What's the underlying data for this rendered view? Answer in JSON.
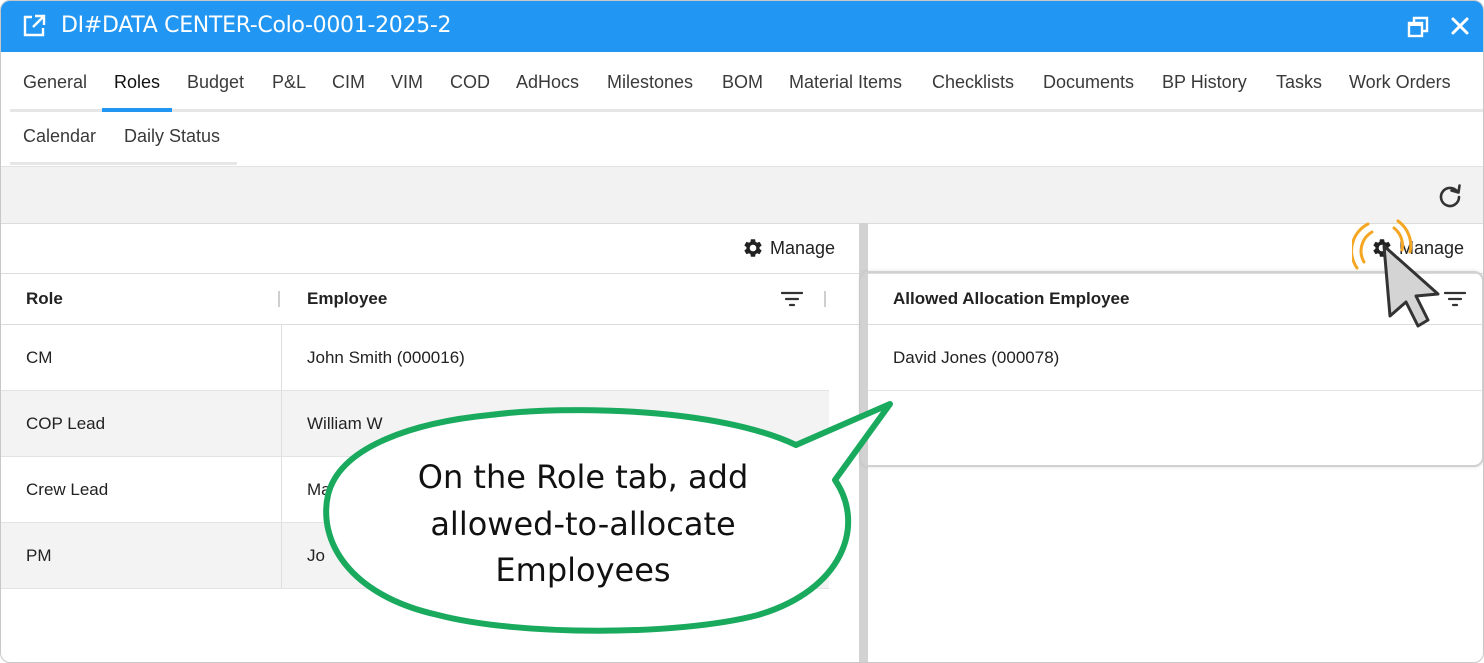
{
  "window": {
    "title": "DI#DATA CENTER-Colo-0001-2025-2",
    "accent_color": "#2196f3",
    "icons": {
      "title": "open-external-icon",
      "restore": "restore-window-icon",
      "close": "close-icon"
    }
  },
  "tabs": [
    {
      "label": "General"
    },
    {
      "label": "Roles",
      "active": true
    },
    {
      "label": "Budget"
    },
    {
      "label": "P&L"
    },
    {
      "label": "CIM"
    },
    {
      "label": "VIM"
    },
    {
      "label": "COD"
    },
    {
      "label": "AdHocs"
    },
    {
      "label": "Milestones"
    },
    {
      "label": "BOM"
    },
    {
      "label": "Material Items"
    },
    {
      "label": "Checklists"
    },
    {
      "label": "Documents"
    },
    {
      "label": "BP History"
    },
    {
      "label": "Tasks"
    },
    {
      "label": "Work Orders"
    },
    {
      "label": "Calendar"
    },
    {
      "label": "Daily Status"
    }
  ],
  "toolbar": {
    "refresh_icon": "refresh-icon"
  },
  "roles_grid": {
    "manage_label": "Manage",
    "columns": [
      "Role",
      "Employee"
    ],
    "rows": [
      {
        "role": "CM",
        "employee": "John Smith (000016)"
      },
      {
        "role": "COP Lead",
        "employee": "William W"
      },
      {
        "role": "Crew Lead",
        "employee": "Ma"
      },
      {
        "role": "PM",
        "employee": "Jo"
      }
    ]
  },
  "allocation_grid": {
    "manage_label": "Manage",
    "columns": [
      "Allowed Allocation Employee"
    ],
    "rows": [
      {
        "employee": "David Jones (000078)"
      }
    ]
  },
  "callout": {
    "text": "On the Role tab, add allowed-to-allocate Employees",
    "border_color": "#1aaa5e"
  },
  "cursor": {
    "icon": "pointer-cursor-icon",
    "ring_color": "#f5a623"
  }
}
